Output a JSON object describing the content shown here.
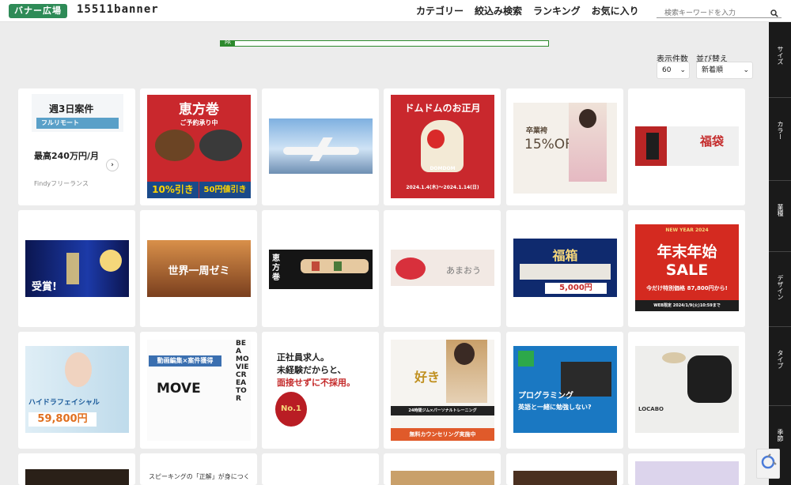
{
  "header": {
    "logo": "バナー広場",
    "site_name": "15511banner",
    "nav": [
      "カテゴリー",
      "絞込み検索",
      "ランキング",
      "お気に入り"
    ],
    "search_placeholder": "検索キーワードを入力"
  },
  "sidebar": {
    "tabs": [
      "サイズ",
      "カラー",
      "業種",
      "デザイン",
      "タイプ",
      "季節"
    ]
  },
  "pr": {
    "label": "PR"
  },
  "controls": {
    "count_label": "表示件数",
    "count_value": "60",
    "sort_label": "並び替え",
    "sort_value": "新着順"
  },
  "ad": {
    "top": "週3日案件",
    "mid": "フルリモート",
    "salary": "最高240万円/月",
    "brand": "Findyフリーランス"
  },
  "banners": [
    {
      "text": "恵方巻",
      "sub": "ご予約承り中",
      "extra": "10%引き",
      "extra2": "50円値引き"
    },
    {
      "text": "",
      "sub": "",
      "extra": "",
      "extra2": ""
    },
    {
      "text": "ドムドムのお正月",
      "sub": "DOMDOM",
      "extra": "2024.1.4(木)～2024.1.14(日)",
      "extra2": ""
    },
    {
      "text": "卒業袴",
      "sub": "15%OFF",
      "extra": "",
      "extra2": ""
    },
    {
      "text": "福袋",
      "sub": "",
      "extra": "",
      "extra2": ""
    },
    {
      "text": "受賞!",
      "sub": "",
      "extra": "",
      "extra2": ""
    },
    {
      "text": "世界一周ゼミ",
      "sub": "",
      "extra": "",
      "extra2": ""
    },
    {
      "text": "恵方巻",
      "sub": "",
      "extra": "",
      "extra2": ""
    },
    {
      "text": "あまおう",
      "sub": "",
      "extra": "",
      "extra2": ""
    },
    {
      "text": "福箱",
      "sub": "5,000円",
      "extra": "",
      "extra2": ""
    },
    {
      "text": "年末年始 SALE",
      "sub": "NEW YEAR 2024",
      "extra": "今だけ特別価格 87,800円から!",
      "extra2": "WEB限定 2024/1/9(火)10:59まで"
    },
    {
      "text": "ハイドラフェイシャル",
      "sub": "59,800円",
      "extra": "",
      "extra2": ""
    },
    {
      "text": "MOVE",
      "sub": "動画編集×案件獲得",
      "extra": "BE A MOVIE CREATOR",
      "extra2": ""
    },
    {
      "text": "正社員求人。",
      "sub": "未経験だからと、",
      "extra": "面接せずに不採用。",
      "extra2": "No.1"
    },
    {
      "text": "好き",
      "sub": "24時間ジム×パーソナルトレーニング",
      "extra": "無料カウンセリング実施中",
      "extra2": ""
    },
    {
      "text": "プログラミング",
      "sub": "英語と一緒に勉強しない?",
      "extra": "",
      "extra2": ""
    },
    {
      "text": "LOCABO",
      "sub": "",
      "extra": "",
      "extra2": ""
    },
    {
      "text": "",
      "sub": "",
      "extra": "",
      "extra2": ""
    },
    {
      "text": "スピーキングの「正解」が身につく",
      "sub": "",
      "extra": "",
      "extra2": ""
    },
    {
      "text": "",
      "sub": "",
      "extra": "",
      "extra2": ""
    },
    {
      "text": "",
      "sub": "",
      "extra": "",
      "extra2": ""
    },
    {
      "text": "",
      "sub": "",
      "extra": "",
      "extra2": ""
    },
    {
      "text": "",
      "sub": "",
      "extra": "",
      "extra2": ""
    }
  ],
  "colors": {
    "brand": "#2e8b57",
    "sidebar": "#1a1a1a",
    "bg": "#ececec"
  }
}
